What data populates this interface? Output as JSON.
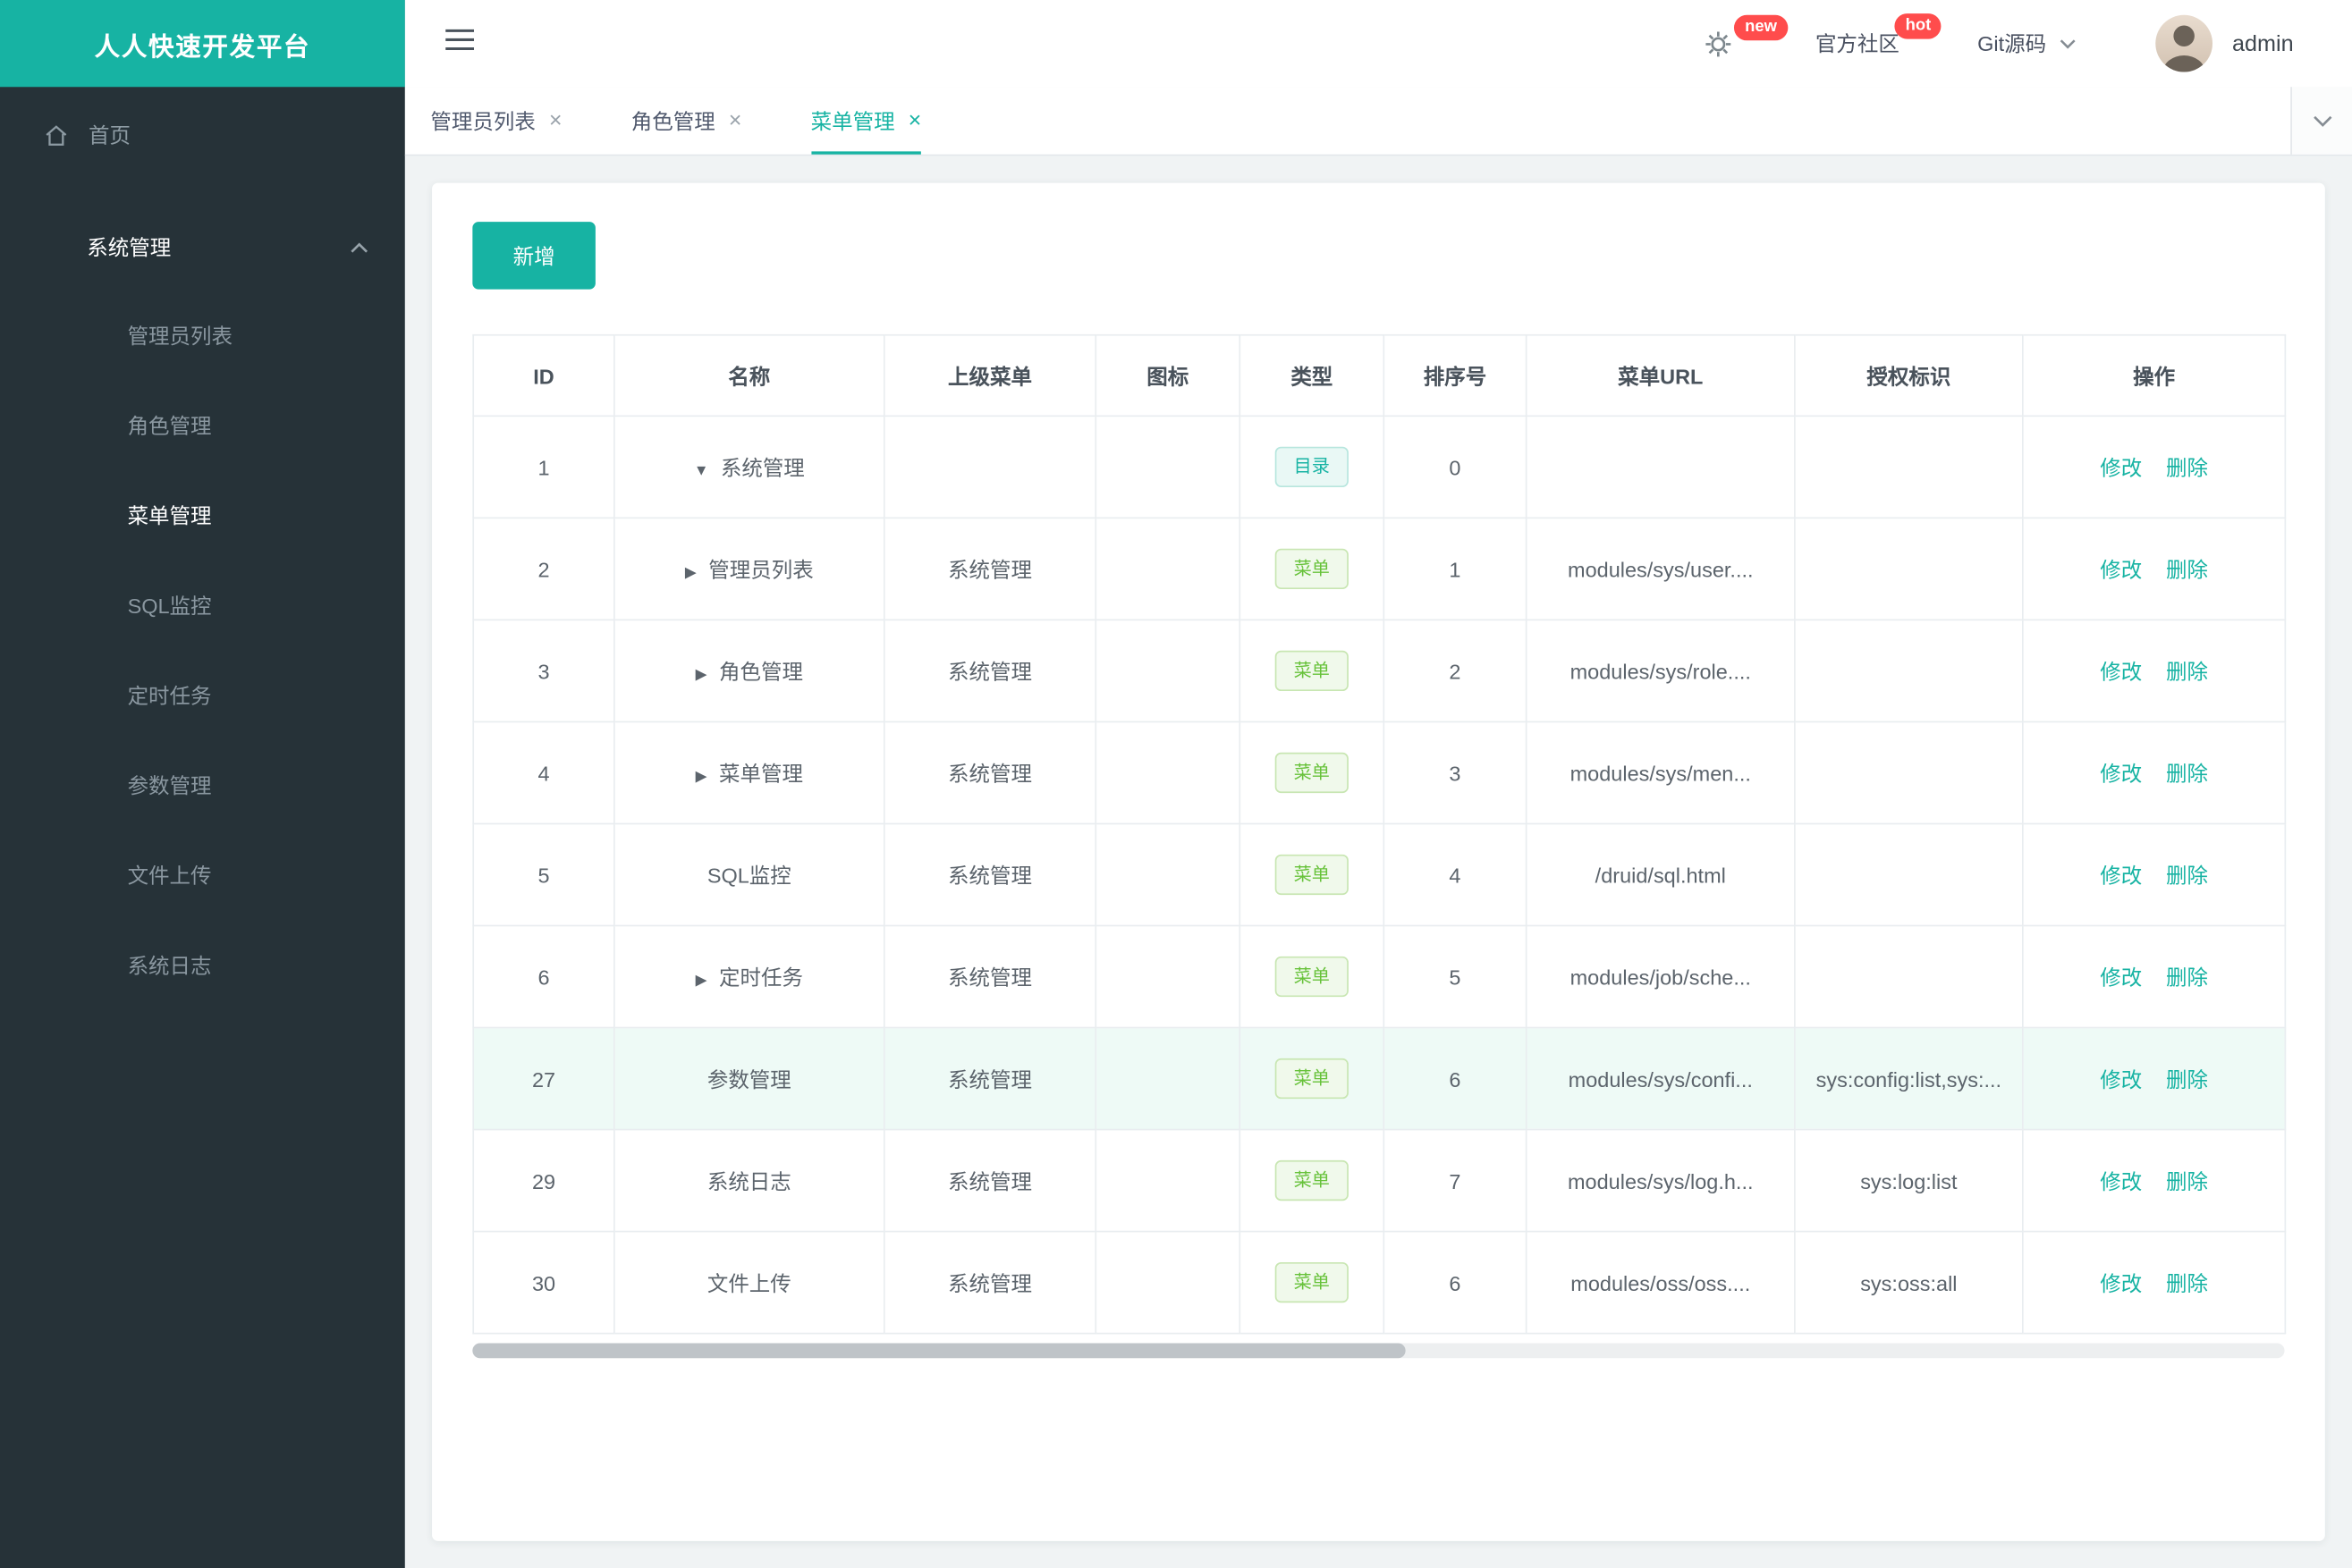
{
  "brand": {
    "title": "人人快速开发平台"
  },
  "topbar": {
    "gear_badge": "new",
    "community_label": "官方社区",
    "community_badge": "hot",
    "git_label": "Git源码",
    "username": "admin"
  },
  "sidebar": {
    "home_label": "首页",
    "group_label": "系统管理",
    "items": [
      "管理员列表",
      "角色管理",
      "菜单管理",
      "SQL监控",
      "定时任务",
      "参数管理",
      "文件上传",
      "系统日志"
    ]
  },
  "tabs": {
    "close_glyph": "×",
    "items": [
      "管理员列表",
      "角色管理",
      "菜单管理"
    ]
  },
  "content": {
    "add_button_label": "新增",
    "table": {
      "columns": [
        "ID",
        "名称",
        "上级菜单",
        "图标",
        "类型",
        "排序号",
        "菜单URL",
        "授权标识",
        "操作"
      ],
      "actions": {
        "edit": "修改",
        "delete": "删除"
      },
      "rows": [
        {
          "id": "1",
          "arrow": "▼",
          "name": "系统管理",
          "parent": "",
          "icon": "",
          "type": "目录",
          "order": "0",
          "url": "",
          "perms": ""
        },
        {
          "id": "2",
          "arrow": "▶",
          "name": "管理员列表",
          "parent": "系统管理",
          "icon": "",
          "type": "菜单",
          "order": "1",
          "url": "modules/sys/user....",
          "perms": ""
        },
        {
          "id": "3",
          "arrow": "▶",
          "name": "角色管理",
          "parent": "系统管理",
          "icon": "",
          "type": "菜单",
          "order": "2",
          "url": "modules/sys/role....",
          "perms": ""
        },
        {
          "id": "4",
          "arrow": "▶",
          "name": "菜单管理",
          "parent": "系统管理",
          "icon": "",
          "type": "菜单",
          "order": "3",
          "url": "modules/sys/men...",
          "perms": ""
        },
        {
          "id": "5",
          "arrow": "",
          "name": "SQL监控",
          "parent": "系统管理",
          "icon": "",
          "type": "菜单",
          "order": "4",
          "url": "/druid/sql.html",
          "perms": ""
        },
        {
          "id": "6",
          "arrow": "▶",
          "name": "定时任务",
          "parent": "系统管理",
          "icon": "",
          "type": "菜单",
          "order": "5",
          "url": "modules/job/sche...",
          "perms": ""
        },
        {
          "id": "27",
          "arrow": "",
          "name": "参数管理",
          "parent": "系统管理",
          "icon": "",
          "type": "菜单",
          "order": "6",
          "url": "modules/sys/confi...",
          "perms": "sys:config:list,sys:..."
        },
        {
          "id": "29",
          "arrow": "",
          "name": "系统日志",
          "parent": "系统管理",
          "icon": "",
          "type": "菜单",
          "order": "7",
          "url": "modules/sys/log.h...",
          "perms": "sys:log:list"
        },
        {
          "id": "30",
          "arrow": "",
          "name": "文件上传",
          "parent": "系统管理",
          "icon": "",
          "type": "菜单",
          "order": "6",
          "url": "modules/oss/oss....",
          "perms": "sys:oss:all"
        }
      ]
    }
  },
  "colors": {
    "accent": "#17b3a3",
    "sidebar_bg": "#263238",
    "tag_menu_green": "#67c23a",
    "badge_red": "#ff4c4c",
    "highlight_row": "#eefaf6"
  }
}
